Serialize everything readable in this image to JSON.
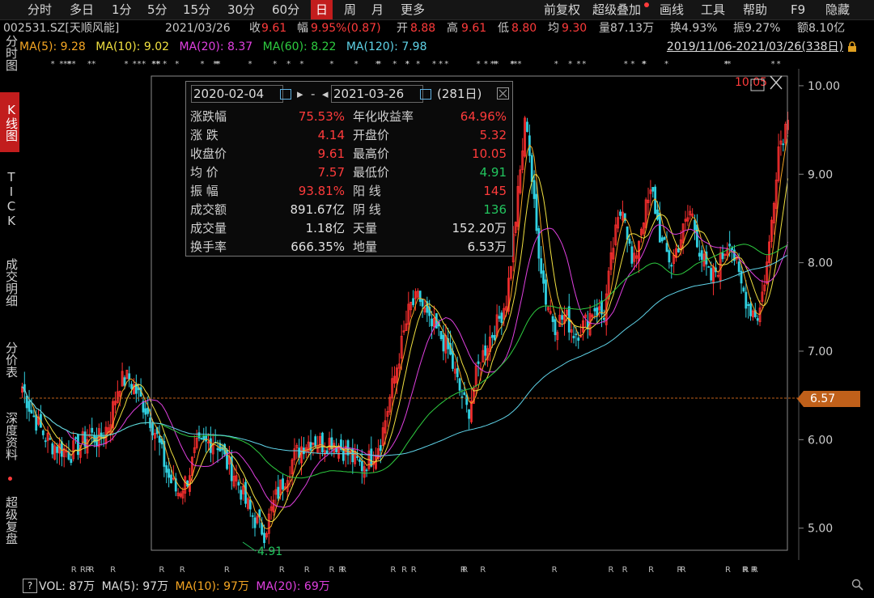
{
  "toolbar": {
    "periods": [
      "分时",
      "多日",
      "1分",
      "5分",
      "15分",
      "30分",
      "60分",
      "日",
      "周",
      "月",
      "更多"
    ],
    "active_period": "日",
    "right_items": [
      "前复权",
      "超级叠加",
      "画线",
      "工具",
      "帮助",
      "F9",
      "隐藏"
    ],
    "super_overlay_dot_color": "#ff3b3b"
  },
  "info": {
    "code_name": "002531.SZ[天顺风能]",
    "date": "2021/03/26",
    "close_label": "收",
    "close_value": "9.61",
    "change_label": "幅",
    "change_value": "9.95%(0.87)",
    "open_label": "开",
    "open_value": "8.88",
    "high_label": "高",
    "high_value": "9.61",
    "low_label": "低",
    "low_value": "8.80",
    "avg_label": "均",
    "avg_value": "9.30",
    "volume": "量87.13万",
    "turnover": "换4.93%",
    "amplitude": "振9.27%",
    "amount": "额8.10亿"
  },
  "ma": [
    {
      "label": "MA(5): 9.28",
      "color": "#f5a623"
    },
    {
      "label": "MA(10): 9.02",
      "color": "#f0e040"
    },
    {
      "label": "MA(20): 8.37",
      "color": "#e040e0"
    },
    {
      "label": "MA(60): 8.22",
      "color": "#2ecc40"
    },
    {
      "label": "MA(120): 7.98",
      "color": "#5fd3e8"
    }
  ],
  "date_range": "2019/11/06-2021/03/26(338日)",
  "side_tabs": [
    {
      "label": "分时图",
      "active": false
    },
    {
      "label": "K线图",
      "active": true
    },
    {
      "label": "TICK",
      "active": false
    },
    {
      "label": "成交明细",
      "active": false
    },
    {
      "label": "分价表",
      "active": false
    },
    {
      "label": "深度资料",
      "active": false
    },
    {
      "label": "超级复盘",
      "active": false
    }
  ],
  "panel": {
    "start_date": "2020-02-04",
    "end_date": "2021-03-26",
    "dash": "-",
    "days": "(281日)",
    "rows": [
      [
        "涨跌幅",
        "75.53%",
        "red",
        "年化收益率",
        "64.96%",
        "red"
      ],
      [
        "涨 跌",
        "4.14",
        "red",
        "开盘价",
        "5.32",
        "red"
      ],
      [
        "收盘价",
        "9.61",
        "red",
        "最高价",
        "10.05",
        "red"
      ],
      [
        "均 价",
        "7.57",
        "red",
        "最低价",
        "4.91",
        "grn"
      ],
      [
        "振 幅",
        "93.81%",
        "red",
        "阳 线",
        "145",
        "red"
      ],
      [
        "成交额",
        "891.67亿",
        "white",
        "阴 线",
        "136",
        "grn"
      ],
      [
        "成交量",
        "1.18亿",
        "white",
        "天量",
        "152.20万",
        "white"
      ],
      [
        "换手率",
        "666.35%",
        "white",
        "地量",
        "6.53万",
        "white"
      ]
    ]
  },
  "chart_data": {
    "type": "candlestick",
    "y_ticks": [
      "10.00",
      "9.00",
      "8.00",
      "7.00",
      "6.00",
      "5.00"
    ],
    "ylim": [
      4.75,
      10.1
    ],
    "current_price": "6.57",
    "high_annotation": "10.05",
    "low_annotation": "4.91",
    "close_points": [
      6.6,
      6.3,
      6.1,
      5.95,
      5.9,
      5.85,
      5.95,
      6.05,
      6.0,
      6.2,
      6.65,
      6.7,
      6.5,
      6.3,
      6.0,
      5.6,
      5.4,
      5.55,
      5.9,
      5.95,
      6.0,
      5.75,
      5.6,
      5.3,
      5.1,
      4.95,
      5.3,
      5.55,
      5.8,
      5.95,
      6.0,
      5.95,
      6.0,
      5.9,
      5.8,
      5.7,
      5.8,
      6.0,
      6.5,
      7.0,
      7.5,
      7.6,
      7.3,
      7.2,
      7.0,
      6.6,
      6.3,
      6.8,
      7.1,
      7.3,
      7.6,
      8.6,
      9.7,
      8.4,
      7.6,
      7.3,
      7.4,
      7.2,
      7.3,
      7.5,
      7.4,
      8.2,
      8.7,
      7.9,
      8.5,
      8.8,
      8.2,
      8.0,
      8.3,
      8.6,
      8.1,
      7.8,
      8.0,
      8.3,
      7.8,
      7.5,
      7.4,
      8.1,
      9.3,
      9.61
    ],
    "ma_series": [
      "MA(5)",
      "MA(10)",
      "MA(20)",
      "MA(60)",
      "MA(120)"
    ]
  },
  "vol": {
    "help": "?",
    "vol_label": "VOL: 87万",
    "ma5_label": "MA(5): 97万",
    "ma10_label": "MA(10): 97万",
    "ma20_label": "MA(20): 69万",
    "ma10_color": "#f5a623",
    "ma20_color": "#e040e0"
  }
}
